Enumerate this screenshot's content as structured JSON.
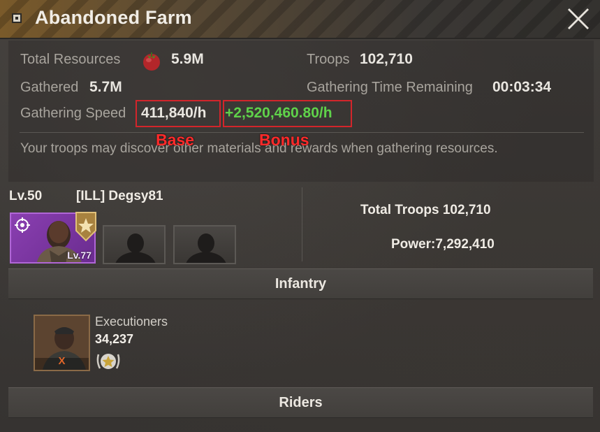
{
  "header": {
    "title": "Abandoned Farm"
  },
  "info": {
    "total_resources_label": "Total Resources",
    "total_resources_value": "5.9M",
    "troops_label": "Troops",
    "troops_value": "102,710",
    "gathered_label": "Gathered",
    "gathered_value": "5.7M",
    "time_remaining_label": "Gathering Time Remaining",
    "time_remaining_value": "00:03:34",
    "speed_label": "Gathering Speed",
    "speed_base": "411,840/h",
    "speed_bonus": "+2,520,460.80/h",
    "annotation_base": "Base",
    "annotation_bonus": "Bonus",
    "note": "Your troops may discover other materials and rewards when gathering resources."
  },
  "commander": {
    "level": "Lv.50",
    "player_name": "[ILL] Degsy81",
    "hero_level": "Lv.77",
    "total_troops": "Total Troops 102,710",
    "power": "Power:7,292,410"
  },
  "sections": {
    "infantry": "Infantry",
    "riders": "Riders"
  },
  "troops": [
    {
      "name": "Executioners",
      "count": "34,237",
      "tier_mark": "X"
    }
  ],
  "colors": {
    "bonus_green": "#5fd24a",
    "highlight_red": "#d3252b",
    "hero_purple": "#8a3fb1"
  },
  "icons": [
    "close-icon",
    "tomato-icon",
    "crosshair-icon",
    "rank-badge-icon",
    "star-laurel-icon"
  ]
}
